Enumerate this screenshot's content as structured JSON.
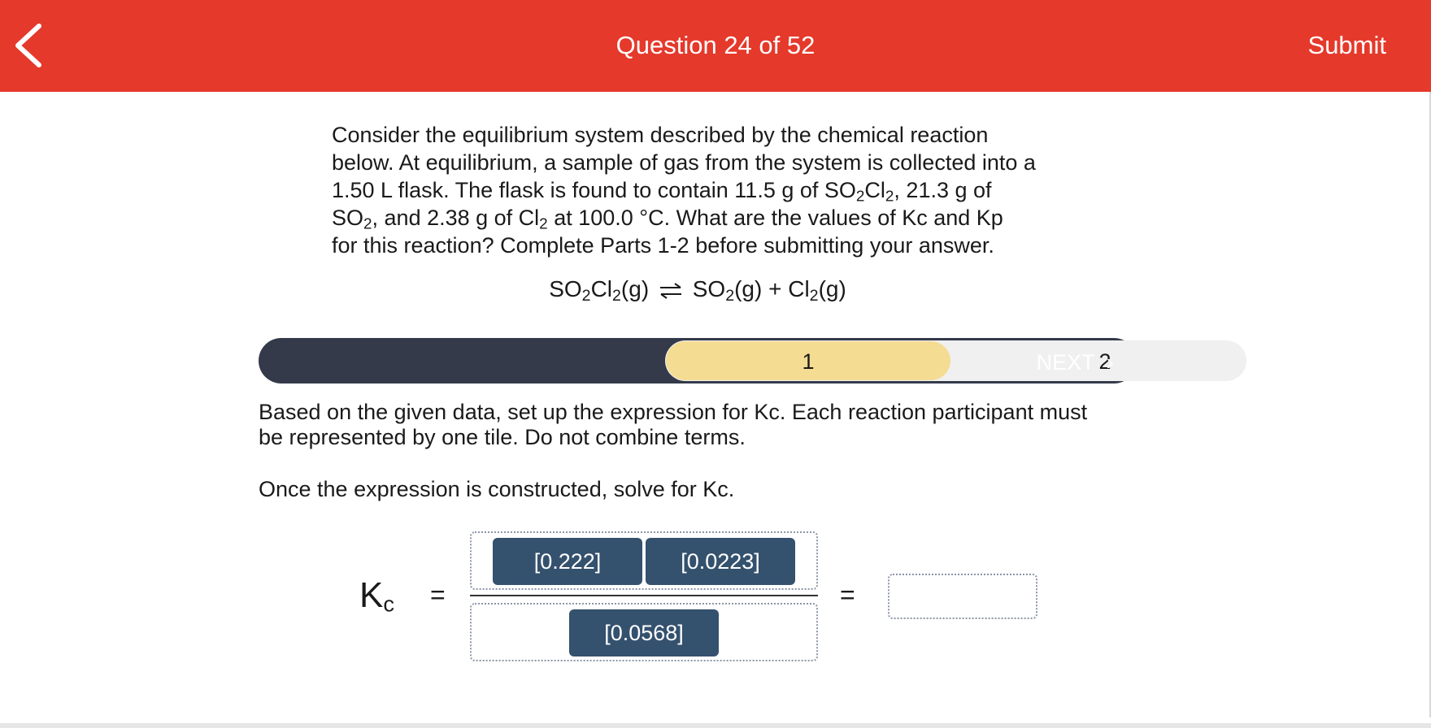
{
  "header": {
    "title": "Question 24 of 52",
    "submit_label": "Submit",
    "back_icon": "chevron-left-icon"
  },
  "question": {
    "line1": "Consider the equilibrium system described by the chemical reaction",
    "line2": "below. At equilibrium, a sample of gas from the system is collected into a",
    "line3a": "1.50 L flask. The flask is found to contain 11.5 g of SO",
    "line3b": "2",
    "line3c": "Cl",
    "line3d": "2",
    "line3e": ", 21.3 g of",
    "line4a": "SO",
    "line4b": "2",
    "line4c": ", and 2.38 g of  Cl",
    "line4d": "2",
    "line4e": " at 100.0 °C. What are the values of Kc and Kp",
    "line5": "for this reaction? Complete Parts 1-2 before submitting your answer."
  },
  "reaction": {
    "r1": "SO",
    "r1s": "2",
    "r2": "Cl",
    "r2s": "2",
    "r3": "(g)",
    "p1": "SO",
    "p1s": "2",
    "p2": "(g) + Cl",
    "p2s": "2",
    "p3": "(g)"
  },
  "stepper": {
    "step1": "1",
    "step2": "2",
    "next_label": "NEXT",
    "next_icon": "›"
  },
  "instructions": {
    "line1": "Based on the given data, set up the expression for Kc. Each reaction participant must",
    "line2": "be represented by one tile. Do not combine terms.",
    "line3": "Once the expression is constructed, solve for Kc."
  },
  "expression": {
    "k_symbol": "K",
    "k_sub": "c",
    "equals": "=",
    "numerator_tiles": [
      "[0.222]",
      "[0.0223]"
    ],
    "denominator_tiles": [
      "[0.0568]"
    ],
    "answer_value": ""
  },
  "colors": {
    "header": "#e5392b",
    "stepper_dark": "#343a4a",
    "stepper_active": "#f5dc93",
    "tile": "#34516e"
  }
}
